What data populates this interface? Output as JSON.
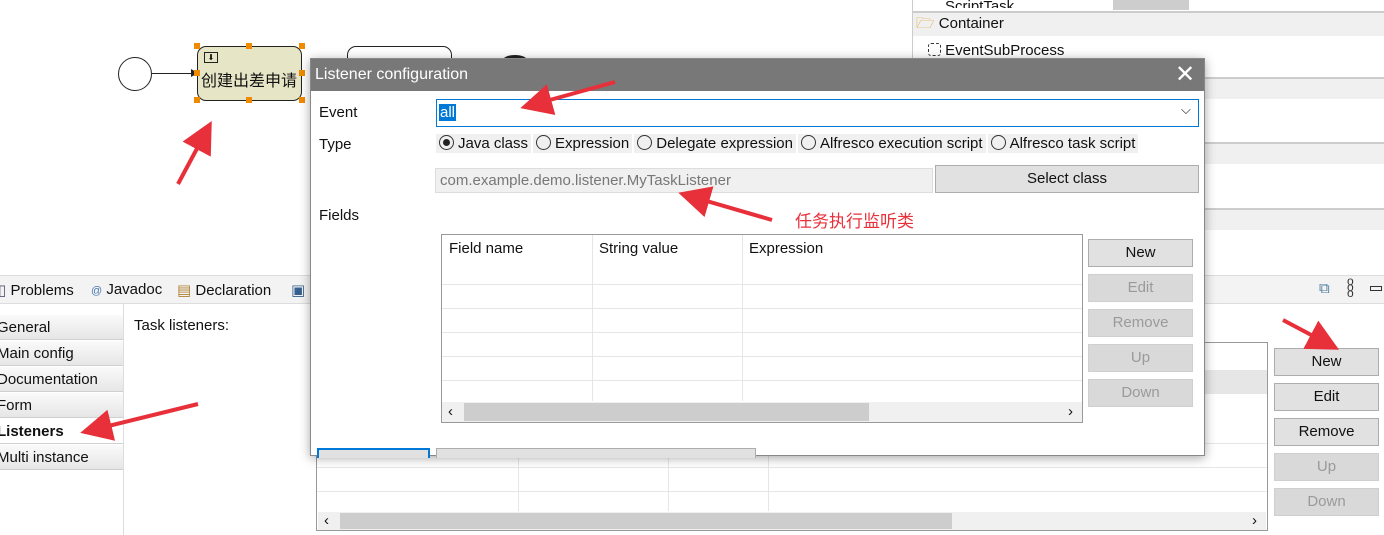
{
  "diagram": {
    "task_label": "创建出差申请"
  },
  "palette": {
    "partial_item": "ScriptTask",
    "container_header": "Container",
    "event_subprocess": "EventSubProcess"
  },
  "bottom": {
    "tabs": [
      {
        "label": "Problems"
      },
      {
        "label": "Javadoc"
      },
      {
        "label": "Declaration"
      }
    ],
    "left_tabs": [
      {
        "label": "General"
      },
      {
        "label": "Main config"
      },
      {
        "label": "Documentation"
      },
      {
        "label": "Form"
      },
      {
        "label": "Listeners",
        "active": true
      },
      {
        "label": "Multi instance"
      }
    ],
    "task_listeners_label": "Task listeners:",
    "buttons": {
      "new": "New",
      "edit": "Edit",
      "remove": "Remove",
      "up": "Up",
      "down": "Down"
    }
  },
  "dialog": {
    "title": "Listener configuration",
    "event_label": "Event",
    "event_value": "all",
    "type_label": "Type",
    "type_options": [
      {
        "label": "Java class",
        "selected": true
      },
      {
        "label": "Expression"
      },
      {
        "label": "Delegate expression"
      },
      {
        "label": "Alfresco execution script"
      },
      {
        "label": "Alfresco task script"
      }
    ],
    "class_value": "com.example.demo.listener.MyTaskListener",
    "select_class": "Select class",
    "fields_label": "Fields",
    "columns": [
      "Field name",
      "String value",
      "Expression"
    ],
    "buttons": {
      "new": "New",
      "edit": "Edit",
      "remove": "Remove",
      "up": "Up",
      "down": "Down"
    }
  },
  "annotation": {
    "text": "任务执行监听类",
    "color": "#e8303a"
  },
  "colors": {
    "title_bar": "#787878",
    "accent": "#0078d7",
    "task_fill": "#e6e5c6"
  }
}
